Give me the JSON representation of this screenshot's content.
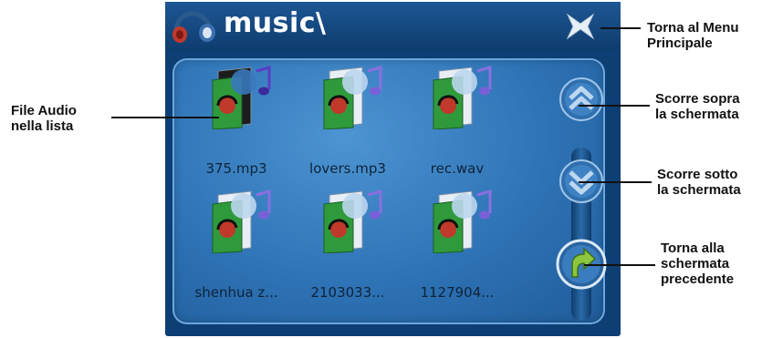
{
  "window": {
    "title": "music\\",
    "colors": {
      "frame": "#0d3f74",
      "panel": "#2e73b6",
      "accent": "#8cc63f"
    }
  },
  "files": [
    {
      "name": "375.mp3",
      "icon": "audio-file-icon",
      "selected": true
    },
    {
      "name": "lovers.mp3",
      "icon": "audio-file-icon",
      "selected": false
    },
    {
      "name": "rec.wav",
      "icon": "audio-file-icon",
      "selected": false
    },
    {
      "name": "shenhua z...",
      "icon": "audio-file-icon",
      "selected": false
    },
    {
      "name": "2103033...",
      "icon": "audio-file-icon",
      "selected": false
    },
    {
      "name": "1127904...",
      "icon": "audio-file-icon",
      "selected": false
    }
  ],
  "buttons": {
    "close": {
      "icon": "close-icon"
    },
    "scroll_up": {
      "icon": "double-chevron-up-icon"
    },
    "scroll_down": {
      "icon": "double-chevron-down-icon"
    },
    "back": {
      "icon": "back-arrow-icon"
    }
  },
  "annotations": {
    "file_list": "File Audio\nnella lista",
    "main_menu": "Torna al Menu\nPrincipale",
    "scroll_up": "Scorre sopra\nla schermata",
    "scroll_down": "Scorre sotto\nla schermata",
    "back": "Torna alla\nschermata\nprecedente"
  }
}
